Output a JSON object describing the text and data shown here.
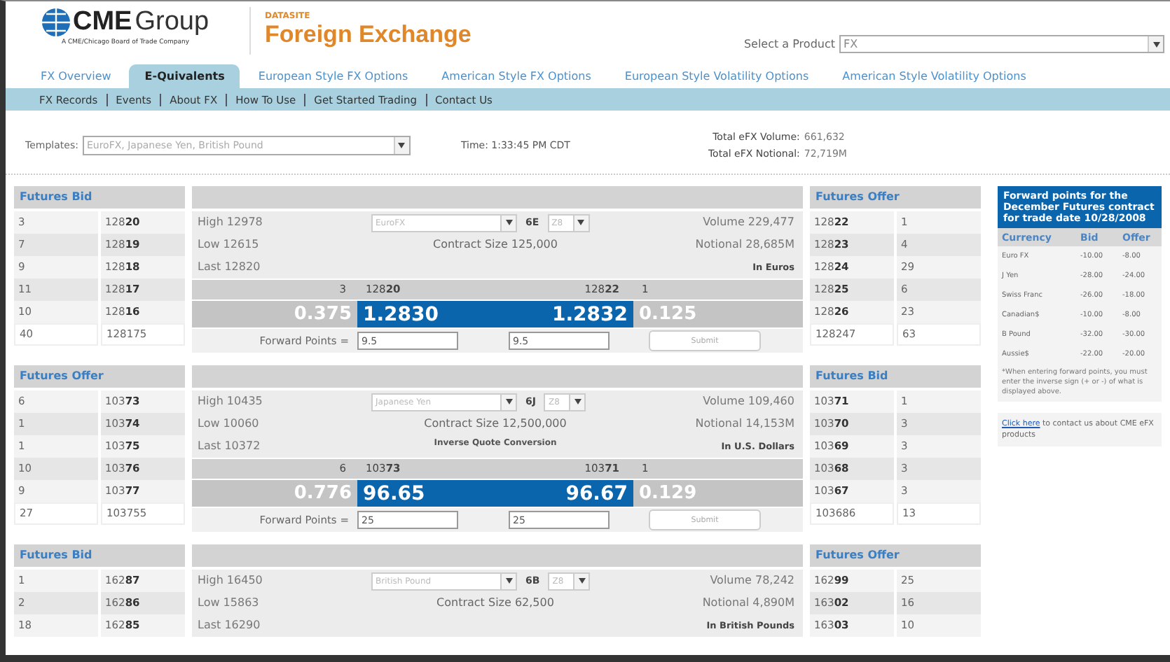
{
  "header": {
    "logo_bold": "CME",
    "logo_regular": "Group",
    "tagline": "A CME/Chicago Board of Trade Company",
    "section_label": "DATASITE",
    "title": "Foreign Exchange",
    "product_label": "Select a Product",
    "product_value": "FX"
  },
  "tabs": [
    {
      "label": "FX Overview",
      "selected": false
    },
    {
      "label": "E-Quivalents",
      "selected": true
    },
    {
      "label": "European Style FX Options",
      "selected": false
    },
    {
      "label": "American Style FX Options",
      "selected": false
    },
    {
      "label": "European Style Volatility Options",
      "selected": false
    },
    {
      "label": "American Style Volatility Options",
      "selected": false
    }
  ],
  "subnav": [
    "FX Records",
    "Events",
    "About FX",
    "How To Use",
    "Get Started Trading",
    "Contact Us"
  ],
  "toolbar": {
    "templates_label": "Templates:",
    "templates_value": "EuroFX, Japanese Yen, British Pound",
    "time": "Time: 1:33:45 PM CDT",
    "volume_label": "Total eFX Volume:",
    "volume_value": "661,632",
    "notional_label": "Total eFX Notional:",
    "notional_value": "72,719M"
  },
  "markets": [
    {
      "left": {
        "title": "Futures Bid",
        "rows": [
          {
            "kind": "level",
            "qty": "3",
            "price": "128**20**"
          },
          {
            "kind": "level",
            "qty": "7",
            "price": "128**19**"
          },
          {
            "kind": "level",
            "qty": "9",
            "price": "128**18**"
          },
          {
            "kind": "level",
            "qty": "11",
            "price": "128**17**"
          },
          {
            "kind": "level",
            "qty": "10",
            "price": "128**16**"
          },
          {
            "kind": "total",
            "qty": "40",
            "price": "128175"
          }
        ]
      },
      "center": {
        "high": "High 12978",
        "low": "Low 12615",
        "last": "Last 12820",
        "currency": "EuroFX",
        "code": "6E",
        "month": "Z8",
        "contract_size": "Contract Size 125,000",
        "volume": "Volume 229,477",
        "notional": "Notional 28,685M",
        "quote_unit": "In Euros",
        "quote": {
          "bid_qty": "3",
          "bid_price": "128**20**",
          "offer_price": "128**22**",
          "offer_qty": "1",
          "bid_change": "0.375",
          "bid": "1.2830",
          "offer": "1.2832",
          "offer_change": "0.125",
          "fp_label": "Forward Points =",
          "fp_bid": "9.5",
          "fp_offer": "9.5",
          "submit": "Submit"
        }
      },
      "right": {
        "title": "Futures Offer",
        "rows": [
          {
            "kind": "level",
            "price": "128**22**",
            "qty": "1"
          },
          {
            "kind": "level",
            "price": "128**23**",
            "qty": "4"
          },
          {
            "kind": "level",
            "price": "128**24**",
            "qty": "29"
          },
          {
            "kind": "level",
            "price": "128**25**",
            "qty": "6"
          },
          {
            "kind": "level",
            "price": "128**26**",
            "qty": "23"
          },
          {
            "kind": "total",
            "price": "128247",
            "qty": "63"
          }
        ]
      }
    },
    {
      "left": {
        "title": "Futures Offer",
        "rows": [
          {
            "kind": "level",
            "qty": "6",
            "price": "103**73**"
          },
          {
            "kind": "level",
            "qty": "1",
            "price": "103**74**"
          },
          {
            "kind": "level",
            "qty": "1",
            "price": "103**75**"
          },
          {
            "kind": "level",
            "qty": "10",
            "price": "103**76**"
          },
          {
            "kind": "level",
            "qty": "9",
            "price": "103**77**"
          },
          {
            "kind": "total",
            "qty": "27",
            "price": "103755"
          }
        ]
      },
      "center": {
        "high": "High 10435",
        "low": "Low 10060",
        "last": "Last 10372",
        "currency": "Japanese Yen",
        "code": "6J",
        "month": "Z8",
        "contract_size": "Contract Size 12,500,000",
        "note": "Inverse Quote Conversion",
        "volume": "Volume 109,460",
        "notional": "Notional 14,153M",
        "quote_unit": "In U.S. Dollars",
        "quote": {
          "bid_qty": "6",
          "bid_price": "103**73**",
          "offer_price": "103**71**",
          "offer_qty": "1",
          "bid_change": "0.776",
          "bid": "96.65",
          "offer": "96.67",
          "offer_change": "0.129",
          "fp_label": "Forward Points =",
          "fp_bid": "25",
          "fp_offer": "25",
          "submit": "Submit"
        }
      },
      "right": {
        "title": "Futures Bid",
        "rows": [
          {
            "kind": "level",
            "price": "103**71**",
            "qty": "1"
          },
          {
            "kind": "level",
            "price": "103**70**",
            "qty": "3"
          },
          {
            "kind": "level",
            "price": "103**69**",
            "qty": "3"
          },
          {
            "kind": "level",
            "price": "103**68**",
            "qty": "3"
          },
          {
            "kind": "level",
            "price": "103**67**",
            "qty": "3"
          },
          {
            "kind": "total",
            "price": "103686",
            "qty": "13"
          }
        ]
      }
    },
    {
      "left": {
        "title": "Futures Bid",
        "rows": [
          {
            "kind": "level",
            "qty": "1",
            "price": "162**87**"
          },
          {
            "kind": "level",
            "qty": "2",
            "price": "162**86**"
          },
          {
            "kind": "level",
            "qty": "18",
            "price": "162**85**"
          }
        ]
      },
      "center": {
        "high": "High 16450",
        "low": "Low 15863",
        "last": "Last 16290",
        "currency": "British Pound",
        "code": "6B",
        "month": "Z8",
        "contract_size": "Contract Size 62,500",
        "volume": "Volume 78,242",
        "notional": "Notional 4,890M",
        "quote_unit": "In British Pounds"
      },
      "right": {
        "title": "Futures Offer",
        "rows": [
          {
            "kind": "level",
            "price": "162**99**",
            "qty": "25"
          },
          {
            "kind": "level",
            "price": "163**02**",
            "qty": "16"
          },
          {
            "kind": "level",
            "price": "163**03**",
            "qty": "10"
          }
        ]
      }
    }
  ],
  "sidebar": {
    "title": "Forward points for the December Futures contract for trade date 10/28/2008",
    "columns": [
      "Currency",
      "Bid",
      "Offer"
    ],
    "rows": [
      [
        "Euro FX",
        "-10.00",
        "-8.00"
      ],
      [
        "J Yen",
        "-28.00",
        "-24.00"
      ],
      [
        "Swiss Franc",
        "-26.00",
        "-18.00"
      ],
      [
        "Canadian$",
        "-10.00",
        "-8.00"
      ],
      [
        "B Pound",
        "-32.00",
        "-30.00"
      ],
      [
        "Aussie$",
        "-22.00",
        "-20.00"
      ]
    ],
    "note": "*When entering forward points, you must enter the inverse sign (+ or -) of what is displayed above.",
    "contact_link": "Click here",
    "contact_text": " to contact us about CME eFX products"
  }
}
